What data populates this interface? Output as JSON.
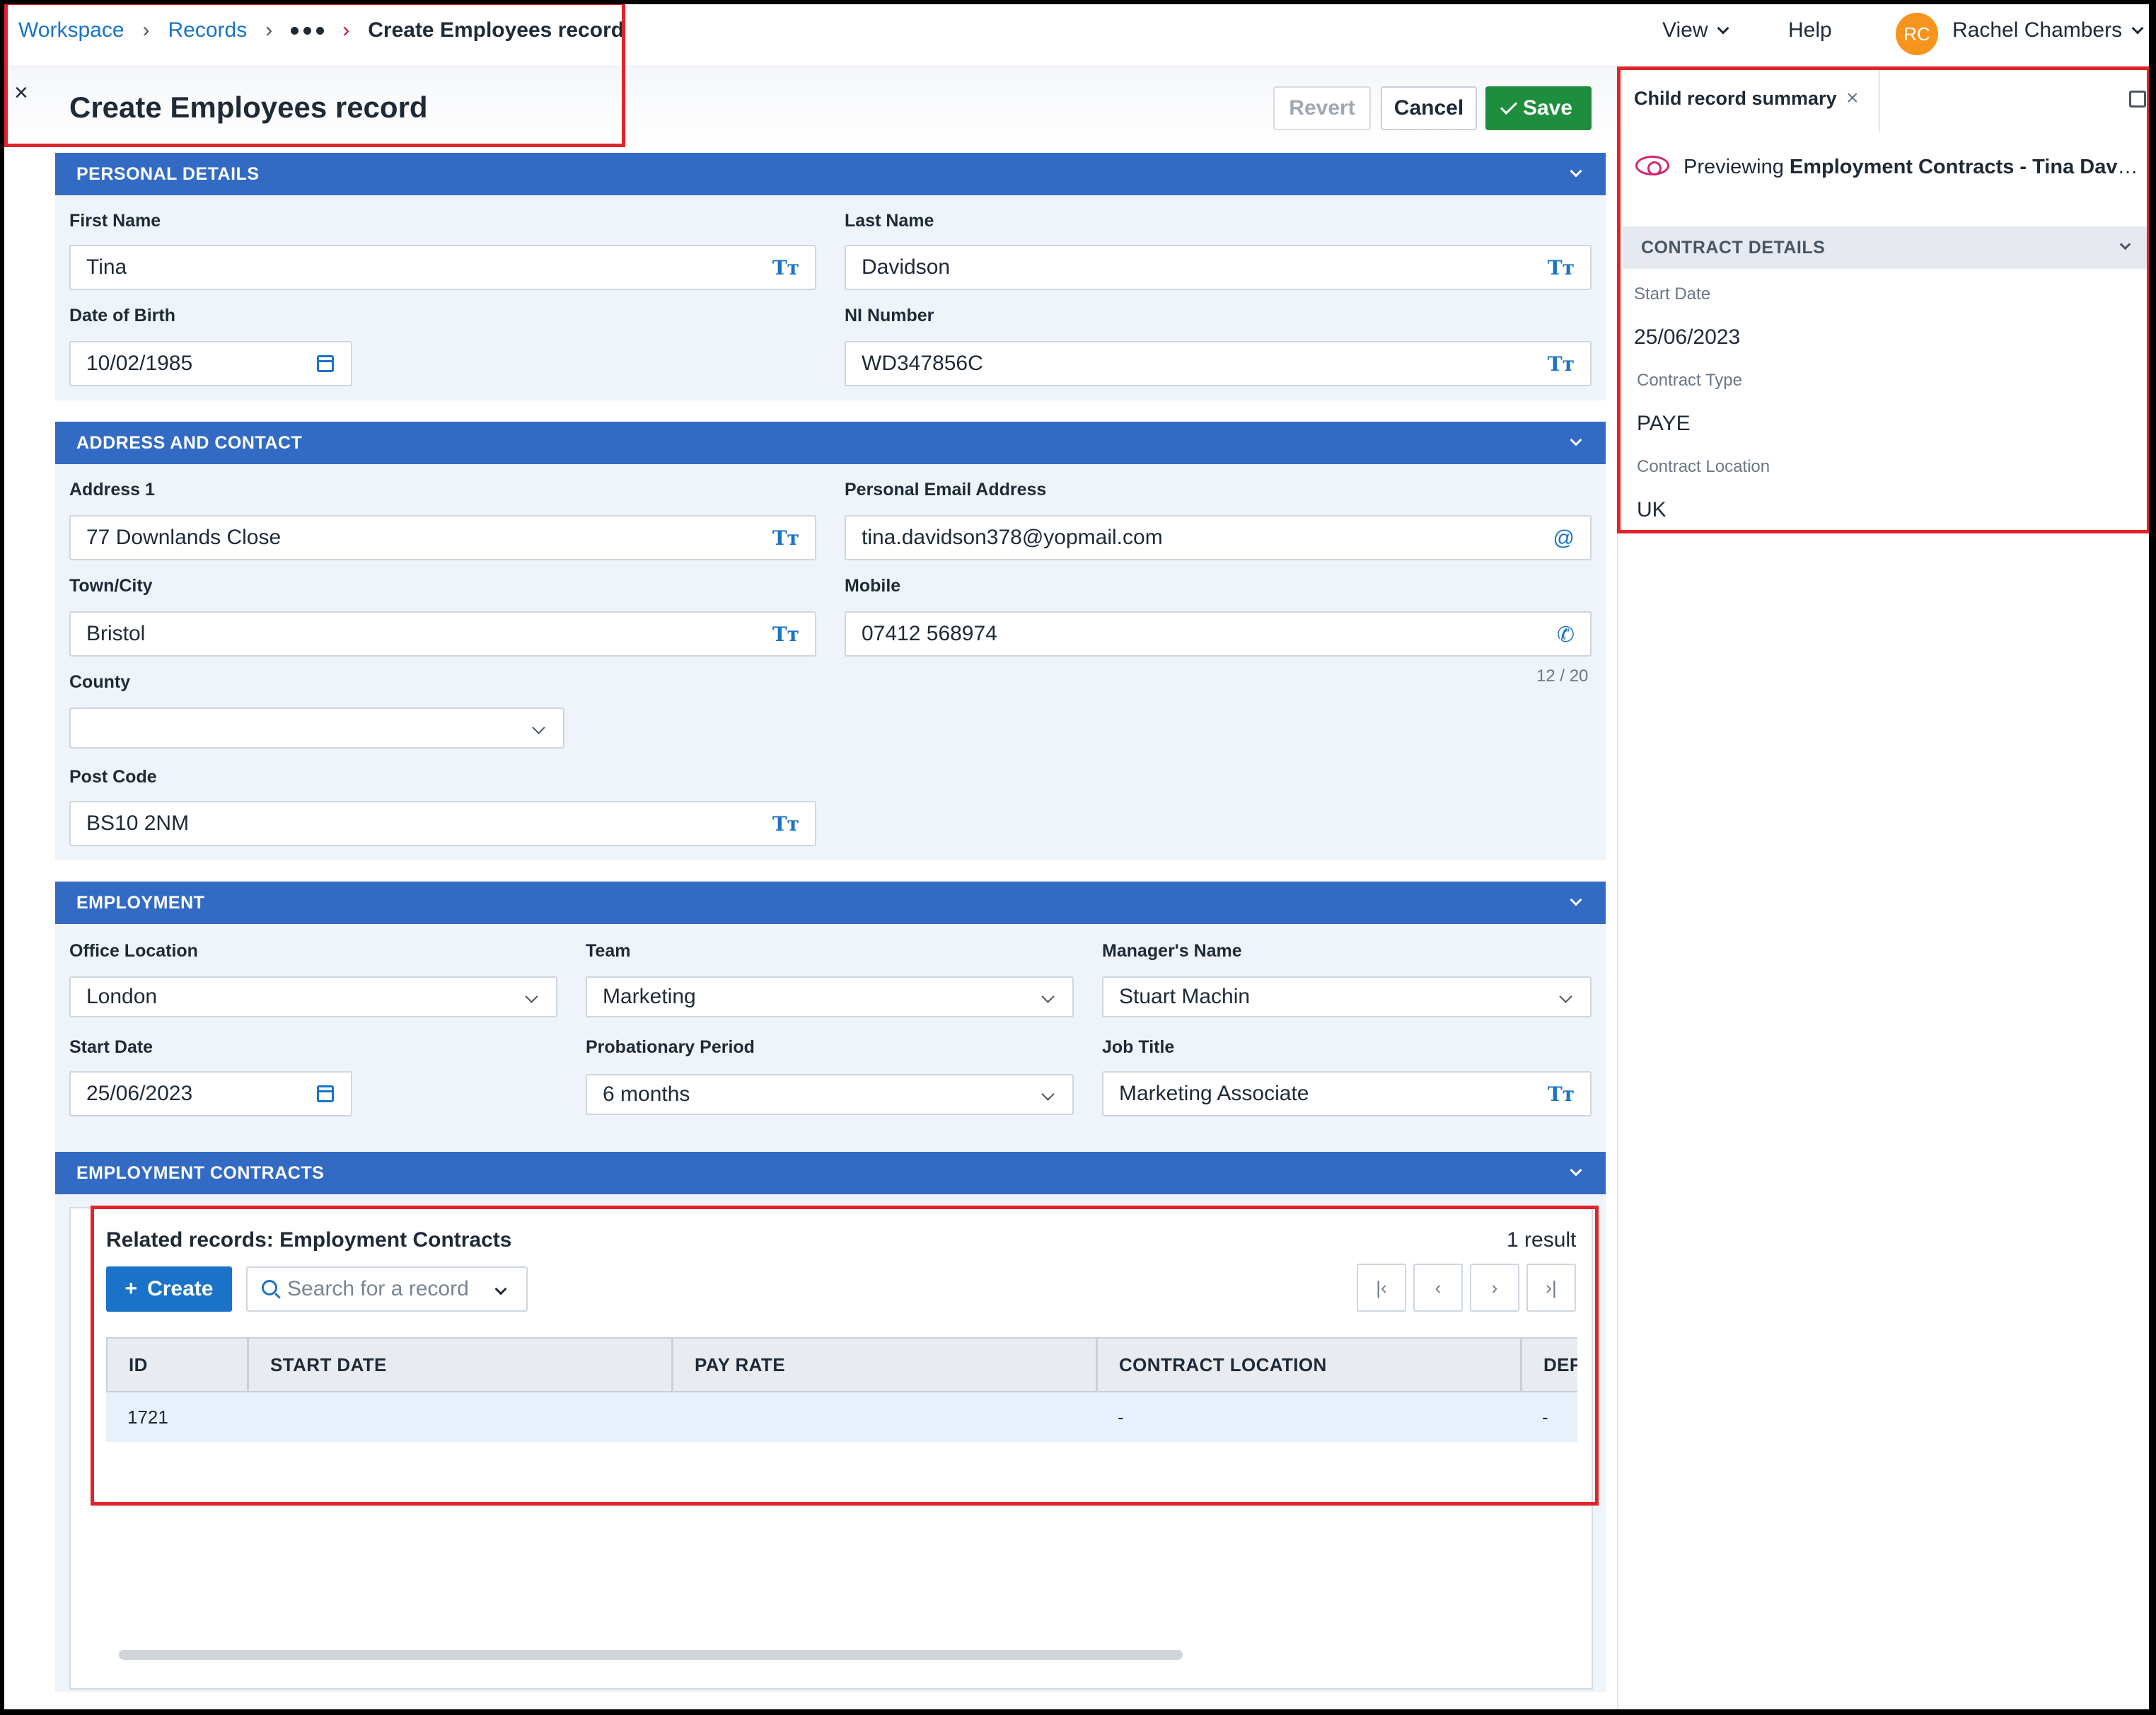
{
  "breadcrumb": {
    "workspace": "Workspace",
    "records": "Records",
    "current": "Create Employees record"
  },
  "topnav": {
    "view": "View",
    "help": "Help",
    "user_initials": "RC",
    "user_name": "Rachel Chambers"
  },
  "header": {
    "title": "Create Employees record",
    "revert": "Revert",
    "cancel": "Cancel",
    "save": "Save"
  },
  "personal": {
    "heading": "PERSONAL DETAILS",
    "first_name_label": "First Name",
    "first_name": "Tina",
    "last_name_label": "Last Name",
    "last_name": "Davidson",
    "dob_label": "Date of Birth",
    "dob": "10/02/1985",
    "ni_label": "NI Number",
    "ni": "WD347856C"
  },
  "address": {
    "heading": "ADDRESS AND CONTACT",
    "address1_label": "Address 1",
    "address1": "77 Downlands Close",
    "email_label": "Personal Email Address",
    "email": "tina.davidson378@yopmail.com",
    "town_label": "Town/City",
    "town": "Bristol",
    "mobile_label": "Mobile",
    "mobile": "07412 568974",
    "mobile_counter": "12 / 20",
    "county_label": "County",
    "county": "",
    "postcode_label": "Post Code",
    "postcode": "BS10 2NM"
  },
  "employment": {
    "heading": "EMPLOYMENT",
    "office_label": "Office Location",
    "office": "London",
    "team_label": "Team",
    "team": "Marketing",
    "manager_label": "Manager's Name",
    "manager": "Stuart Machin",
    "start_label": "Start Date",
    "start": "25/06/2023",
    "probation_label": "Probationary Period",
    "probation": "6 months",
    "job_label": "Job Title",
    "job": "Marketing Associate"
  },
  "contracts": {
    "heading": "EMPLOYMENT CONTRACTS",
    "title": "Related records: Employment Contracts",
    "count": "1 result",
    "create": "Create",
    "search_placeholder": "Search for a record",
    "columns": [
      "ID",
      "START DATE",
      "PAY RATE",
      "CONTRACT LOCATION",
      "DEF"
    ],
    "rows": [
      {
        "id": "1721",
        "start": "",
        "pay": "",
        "location": "-",
        "def": "-"
      }
    ]
  },
  "panel": {
    "tab": "Child record summary",
    "preview_prefix": "Previewing",
    "preview_record": "Employment Contracts - Tina Davidson",
    "section": "CONTRACT DETAILS",
    "start_label": "Start Date",
    "start": "25/06/2023",
    "type_label": "Contract Type",
    "type": "PAYE",
    "location_label": "Contract Location",
    "location": "UK"
  },
  "icons": {
    "text_type": "Tт",
    "email": "@",
    "phone": "✆",
    "close": "×",
    "plus": "+"
  }
}
